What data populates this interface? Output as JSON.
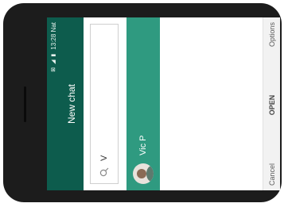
{
  "status_bar": {
    "icons": "⊠ ◢ ▮",
    "time": "13:28 Nat"
  },
  "header": {
    "title": "New chat"
  },
  "search": {
    "value": "V"
  },
  "results": [
    {
      "name": "Vic P"
    }
  ],
  "softkeys": {
    "left": "Cancel",
    "center": "OPEN",
    "right": "Options"
  },
  "colors": {
    "header": "#0d5c4d",
    "selected_row": "#2f9a80"
  }
}
